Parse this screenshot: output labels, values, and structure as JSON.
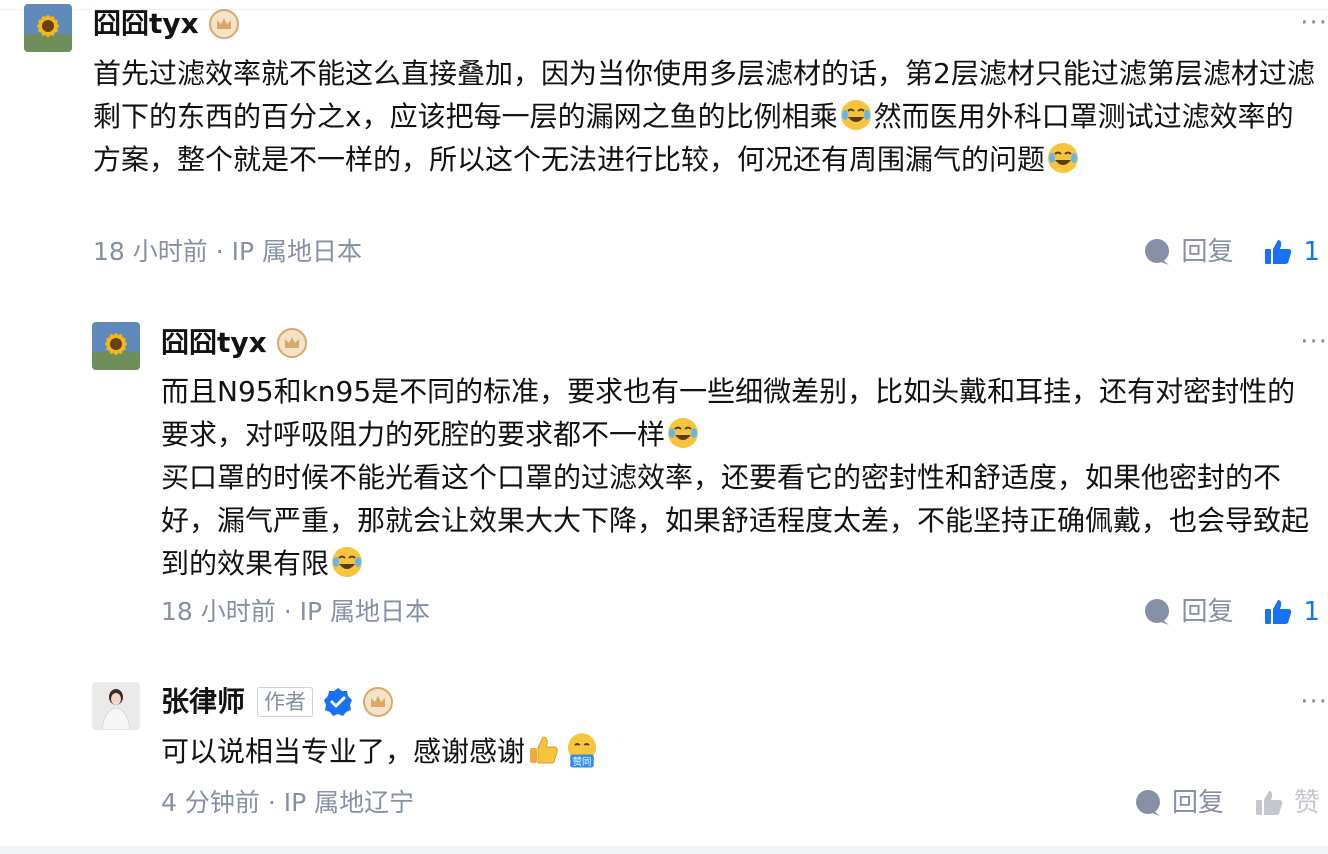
{
  "comments": [
    {
      "username": "囧囧tyx",
      "paragraphs": [
        [
          "首先过滤效率就不能这么直接叠加，因为当你使用多层滤材的话，第2层滤材只能过滤第层滤材过滤剩下的东西的百分之x，应该把每一层的漏网之鱼的比例相乘",
          "然而医用外科口罩测试过滤效率的方案，整个就是不一样的，所以这个无法进行比较，何况还有周围漏气的问题",
          ""
        ]
      ],
      "time": "18 小时前",
      "location": "IP 属地日本",
      "reply_label": "回复",
      "like_count": "1"
    },
    {
      "username": "囧囧tyx",
      "paragraphs": [
        [
          "而且N95和kn95是不同的标准，要求也有一些细微差别，比如头戴和耳挂，还有对密封性的要求，对呼吸阻力的死腔的要求都不一样"
        ],
        [
          "买口罩的时候不能光看这个口罩的过滤效率，还要看它的密封性和舒适度，如果他密封的不好，漏气严重，那就会让效果大大下降，如果舒适程度太差，不能坚持正确佩戴，也会导致起到的效果有限"
        ]
      ],
      "time": "18 小时前",
      "location": "IP 属地日本",
      "reply_label": "回复",
      "like_count": "1"
    },
    {
      "username": "张律师",
      "author_tag": "作者",
      "paragraphs": [
        [
          "可以说相当专业了，感谢感谢"
        ]
      ],
      "emoji_text": "赞同",
      "time": "4 分钟前",
      "location": "IP 属地辽宁",
      "reply_label": "回复",
      "like_label": "赞"
    }
  ],
  "separator": "·",
  "more_label": "···",
  "icons": {
    "badge": "crown-badge-icon",
    "verified": "verified-check-icon",
    "emoji_laugh_cry": "laugh-cry-emoji-icon",
    "emoji_thumbs_up": "thumbs-up-emoji-icon",
    "emoji_agree": "agree-emoji-icon",
    "reply": "reply-bubble-icon",
    "like": "like-thumb-icon"
  },
  "colors": {
    "text": "#121212",
    "meta": "#8590a6",
    "like_active": "#1772f6",
    "like_inactive": "#c4c7ce",
    "badge": "#d9a86a",
    "verified": "#1772f6"
  }
}
